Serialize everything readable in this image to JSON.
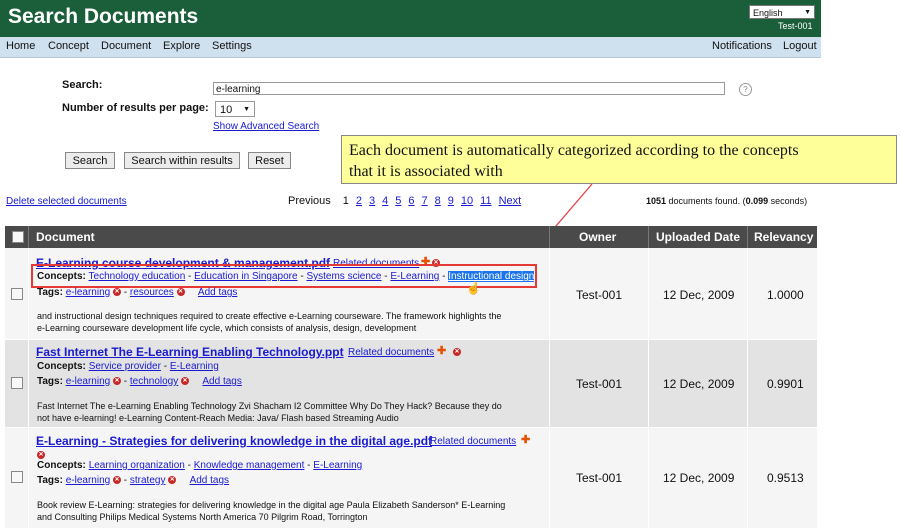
{
  "header": {
    "title": "Search Documents",
    "language": "English",
    "user": "Test-001"
  },
  "nav": {
    "left": [
      "Home",
      "Concept",
      "Document",
      "Explore",
      "Settings"
    ],
    "right": [
      "Notifications",
      "Logout"
    ]
  },
  "search": {
    "label": "Search:",
    "value": "e-learning",
    "help": "?",
    "per_page_label": "Number of results per page:",
    "per_page_value": "10",
    "advanced": "Show Advanced Search",
    "buttons": [
      "Search",
      "Search within results",
      "Reset"
    ]
  },
  "callout": {
    "line1": "Each document is automatically categorized according to the concepts",
    "line2": "that  it is associated with"
  },
  "results": {
    "delete_selected": "Delete selected documents",
    "pager": [
      "Previous",
      "1",
      "2",
      "3",
      "4",
      "5",
      "6",
      "7",
      "8",
      "9",
      "10",
      "11",
      "Next"
    ],
    "found": {
      "count": "1051",
      "text1": " documents found. (",
      "seconds": "0.099",
      "text2": " seconds)"
    }
  },
  "table": {
    "headers": [
      "Document",
      "Owner",
      "Uploaded Date",
      "Relevancy"
    ],
    "concepts_label": "Concepts:",
    "tags_label": "Tags:",
    "related": "Related documents",
    "add_tags": "Add tags",
    "rows": [
      {
        "title": "E-Learning course development & management.pdf",
        "concepts": [
          "Technology education",
          "Education in Singapore",
          "Systems science",
          "E-Learning",
          "Instructional design"
        ],
        "tags": [
          "e-learning",
          "resources"
        ],
        "snippet1": "and instructional design techniques required to create effective e-Learning courseware. The framework highlights the",
        "snippet2": "e-Learning courseware development life cycle, which consists of analysis, design, development",
        "owner": "Test-001",
        "date": "12 Dec, 2009",
        "relevancy": "1.0000"
      },
      {
        "title": "Fast Internet The E-Learning Enabling Technology.ppt",
        "concepts": [
          "Service provider",
          "E-Learning"
        ],
        "tags": [
          "e-learning",
          "technology"
        ],
        "snippet1": "Fast Internet The e-Learning Enabling Technology Zvi Shacham I2 Committee Why Do They Hack? Because they do",
        "snippet2": "not have e-learning! e-Learning Content-Reach Media: Java/ Flash based Streaming Audio",
        "owner": "Test-001",
        "date": "12 Dec, 2009",
        "relevancy": "0.9901"
      },
      {
        "title": "E-Learning - Strategies for delivering knowledge in the digital age.pdf",
        "concepts": [
          "Learning organization",
          "Knowledge management",
          "E-Learning"
        ],
        "tags": [
          "e-learning",
          "strategy"
        ],
        "snippet1": "Book review E-Learning: strategies for delivering knowledge in the digital age Paula Elizabeth Sanderson* E-Learning",
        "snippet2": "and Consulting Philips Medical Systems North America 70 Pilgrim Road, Torrington",
        "owner": "Test-001",
        "date": "12 Dec, 2009",
        "relevancy": "0.9513"
      }
    ]
  }
}
